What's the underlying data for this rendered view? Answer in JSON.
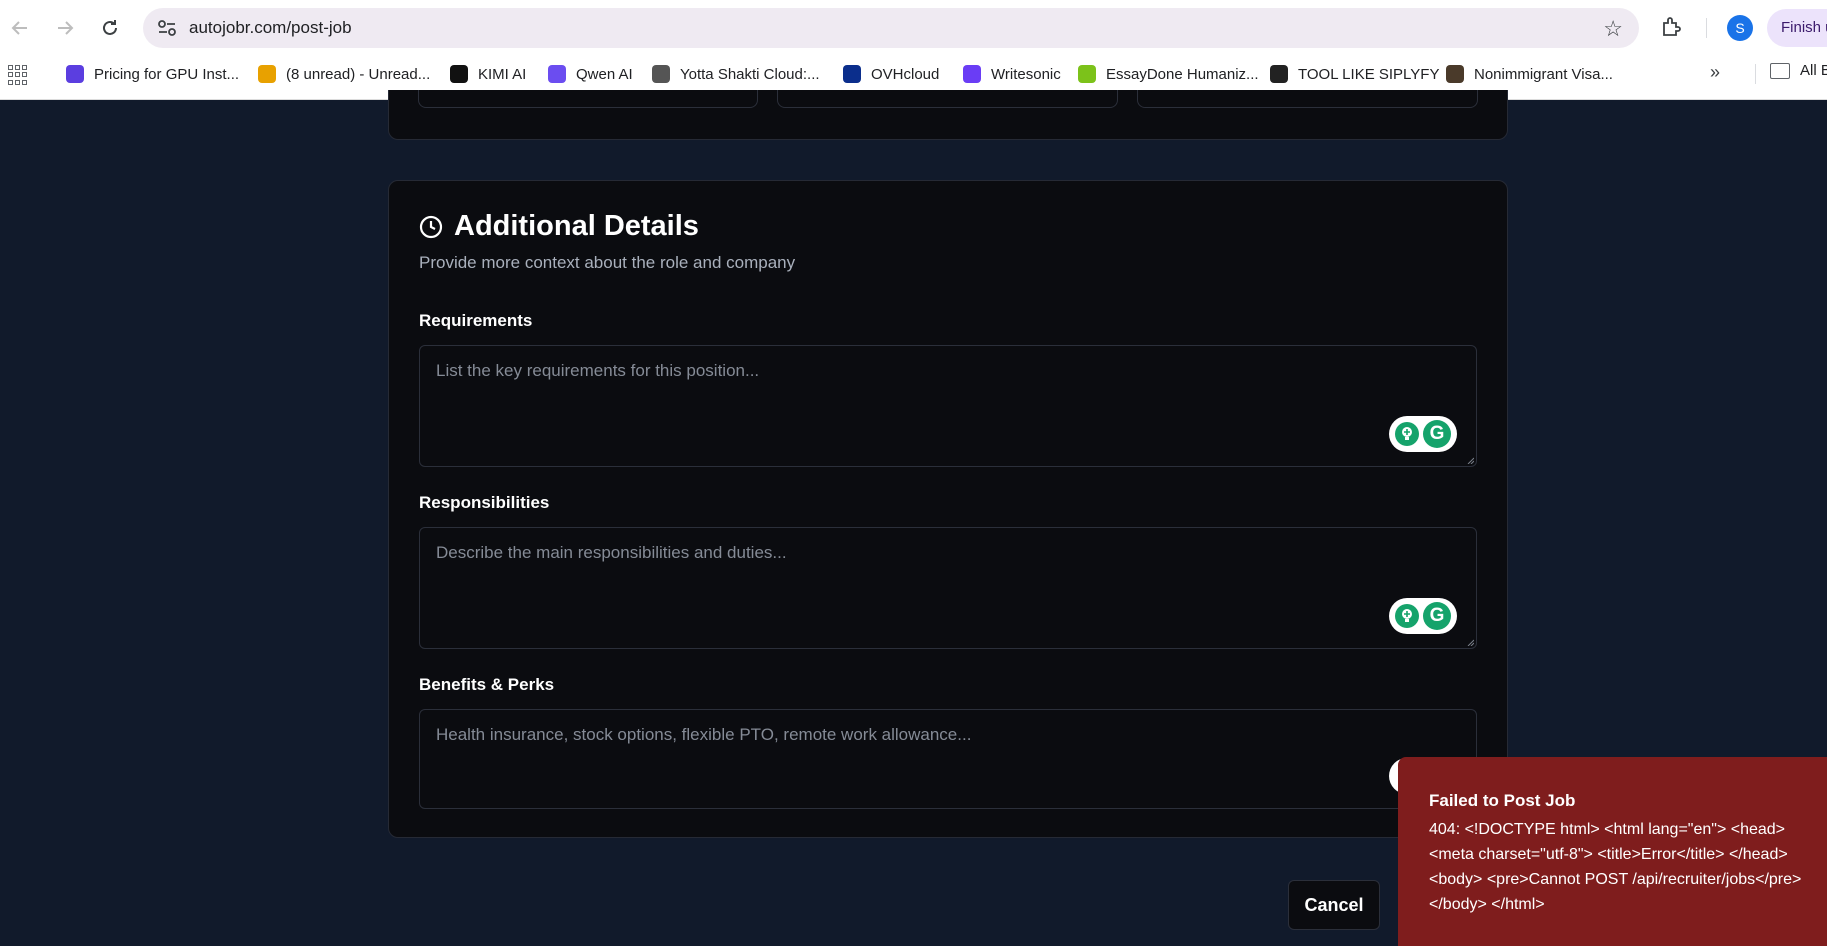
{
  "browser": {
    "url": "autojobr.com/post-job",
    "profile_initial": "S",
    "finish_label": "Finish u",
    "bookmarks": [
      {
        "label": "Pricing for GPU Inst...",
        "icon": "gpu-cloud-icon",
        "color": "#5b3ee0"
      },
      {
        "label": "(8 unread) - Unread...",
        "icon": "chat-icon",
        "color": "#e8a100"
      },
      {
        "label": "KIMI AI",
        "icon": "kimi-icon",
        "color": "#111111"
      },
      {
        "label": "Qwen AI",
        "icon": "qwen-icon",
        "color": "#6b4df0"
      },
      {
        "label": "Yotta Shakti Cloud:...",
        "icon": "globe-icon",
        "color": "#555555"
      },
      {
        "label": "OVHcloud",
        "icon": "ovh-icon",
        "color": "#0b2e8c"
      },
      {
        "label": "Writesonic",
        "icon": "writesonic-icon",
        "color": "#6a3df5"
      },
      {
        "label": "EssayDone Humaniz...",
        "icon": "essaydone-icon",
        "color": "#7cc21a"
      },
      {
        "label": "TOOL LIKE SIPLYFY",
        "icon": "tool-icon",
        "color": "#222222"
      },
      {
        "label": "Nonimmigrant Visa...",
        "icon": "seal-icon",
        "color": "#4a3a2a"
      }
    ],
    "all_bookmarks_label": "All B"
  },
  "section": {
    "title": "Additional Details",
    "subtitle": "Provide more context about the role and company"
  },
  "fields": {
    "requirements": {
      "label": "Requirements",
      "placeholder": "List the key requirements for this position..."
    },
    "responsibilities": {
      "label": "Responsibilities",
      "placeholder": "Describe the main responsibilities and duties..."
    },
    "benefits": {
      "label": "Benefits & Perks",
      "placeholder": "Health insurance, stock options, flexible PTO, remote work allowance..."
    }
  },
  "actions": {
    "cancel_label": "Cancel"
  },
  "toast": {
    "title": "Failed to Post Job",
    "message": "404: <!DOCTYPE html> <html lang=\"en\"> <head> <meta charset=\"utf-8\"> <title>Error</title> </head> <body> <pre>Cannot POST /api/recruiter/jobs</pre> </body> </html>"
  },
  "colors": {
    "page_bg": "#111a2b",
    "card_bg": "#0b0c10",
    "toast_bg": "#7f1d1d",
    "grammarly_green": "#15a36b"
  }
}
